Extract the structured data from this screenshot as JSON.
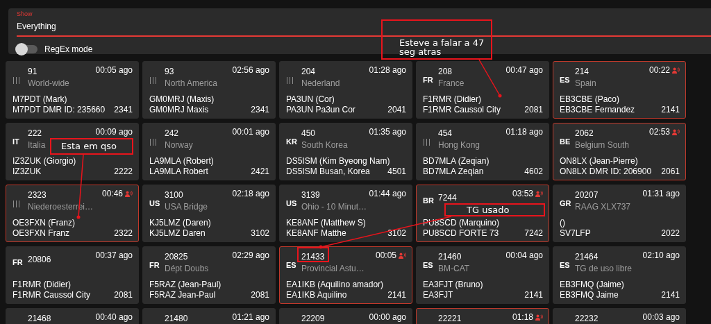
{
  "filter": {
    "label": "Show",
    "value": "Everything",
    "regex_mode": {
      "label": "RegEx mode",
      "on": false
    }
  },
  "cards": [
    {
      "flag_missing": true,
      "tg": "91",
      "name": "World-wide",
      "time": "00:05 ago",
      "talking": false,
      "caller": "M7PDT (Mark)",
      "detail": "M7PDT DMR ID: 235660",
      "id": "2341"
    },
    {
      "flag_missing": true,
      "tg": "93",
      "name": "North America",
      "time": "02:56 ago",
      "talking": false,
      "caller": "GM0MRJ (Maxis)",
      "detail": "GM0MRJ Maxis",
      "id": "2341"
    },
    {
      "flag_missing": true,
      "tg": "204",
      "name": "Nederland",
      "time": "01:28 ago",
      "talking": false,
      "caller": "PA3UN (Cor)",
      "detail": "PA3UN Pa3un Cor",
      "id": "2041"
    },
    {
      "code": "FR",
      "tg": "208",
      "name": "France",
      "time": "00:47 ago",
      "talking": false,
      "caller": "F1RMR (Didier)",
      "detail": "F1RMR Caussol City",
      "id": "2081"
    },
    {
      "code": "ES",
      "tg": "214",
      "name": "Spain",
      "time": "00:22",
      "talking": true,
      "caller": "EB3CBE (Paco)",
      "detail": "EB3CBE Fernandez",
      "id": "2141"
    },
    {
      "code": "IT",
      "tg": "222",
      "name": "Italia",
      "time": "00:09 ago",
      "talking": false,
      "caller": "IZ3ZUK (Giorgio)",
      "detail": "IZ3ZUK",
      "id": "2222"
    },
    {
      "flag_missing": true,
      "tg": "242",
      "name": "Norway",
      "time": "00:01 ago",
      "talking": false,
      "caller": "LA9MLA (Robert)",
      "detail": "LA9MLA Robert",
      "id": "2421"
    },
    {
      "code": "KR",
      "tg": "450",
      "name": "South Korea",
      "time": "01:35 ago",
      "talking": false,
      "caller": "DS5ISM (Kim Byeong Nam)",
      "detail": "DS5ISM Busan, Korea",
      "id": "4501"
    },
    {
      "flag_missing": true,
      "tg": "454",
      "name": "Hong Kong",
      "time": "01:18 ago",
      "talking": false,
      "caller": "BD7MLA (Zeqian)",
      "detail": "BD7MLA Zeqian",
      "id": "4602"
    },
    {
      "code": "BE",
      "tg": "2062",
      "name": "Belgium South",
      "time": "02:53",
      "talking": true,
      "caller": "ON8LX (Jean-Pierre)",
      "detail": "ON8LX DMR ID: 206900",
      "id": "2061"
    },
    {
      "flag_missing": true,
      "tg": "2323",
      "name": "Niederoesterrei…",
      "time": "00:46",
      "talking": true,
      "caller": "OE3FXN (Franz)",
      "detail": "OE3FXN Franz",
      "id": "2322"
    },
    {
      "code": "US",
      "tg": "3100",
      "name": "USA Bridge",
      "time": "02:18 ago",
      "talking": false,
      "caller": "KJ5LMZ (Daren)",
      "detail": "KJ5LMZ Daren",
      "id": "3102"
    },
    {
      "code": "US",
      "tg": "3139",
      "name": "Ohio - 10 Minut…",
      "time": "01:44 ago",
      "talking": false,
      "caller": "KE8ANF (Matthew S)",
      "detail": "KE8ANF Matthe",
      "id": "3102"
    },
    {
      "code": "BR",
      "tg": "7244",
      "time": "03:53",
      "talking": true,
      "caller": "PU8SCD (Marquino)",
      "detail": "PU8SCD FORTE 73",
      "id": "7242"
    },
    {
      "code": "GR",
      "tg": "20207",
      "name": "RAAG XLX737",
      "time": "01:31 ago",
      "talking": false,
      "caller": "()",
      "detail": "SV7LFP",
      "id": "2022"
    },
    {
      "code": "FR",
      "tg": "20806",
      "time": "00:37 ago",
      "talking": false,
      "caller": "F1RMR (Didier)",
      "detail": "F1RMR Caussol City",
      "id": "2081"
    },
    {
      "code": "FR",
      "tg": "20825",
      "name": "Dépt Doubs",
      "time": "02:29 ago",
      "talking": false,
      "caller": "F5RAZ (Jean-Paul)",
      "detail": "F5RAZ Jean-Paul",
      "id": "2081"
    },
    {
      "code": "ES",
      "tg": "21433",
      "name": "Provincial Astu…",
      "time": "00:05",
      "talking": true,
      "caller": "EA1IKB (Aquilino amador)",
      "detail": "EA1IKB Aquilino",
      "id": "2141"
    },
    {
      "code": "ES",
      "tg": "21460",
      "name": "BM-CAT",
      "time": "00:04 ago",
      "talking": false,
      "caller": "EA3FJT (Bruno)",
      "detail": "EA3FJT",
      "id": "2141"
    },
    {
      "code": "ES",
      "tg": "21464",
      "name": "TG de uso libre",
      "time": "02:10 ago",
      "talking": false,
      "caller": "EB3FMQ (Jaime)",
      "detail": "EB3FMQ Jaime",
      "id": "2141"
    },
    {
      "tg": "21468",
      "time": "00:40 ago",
      "talking": false
    },
    {
      "tg": "21480",
      "time": "01:21 ago",
      "talking": false
    },
    {
      "tg": "22209",
      "time": "00:00 ago",
      "talking": false
    },
    {
      "tg": "22221",
      "time": "01:18",
      "talking": true
    },
    {
      "tg": "22232",
      "time": "00:03 ago",
      "talking": false
    }
  ],
  "annotations": [
    {
      "kind": "callout",
      "text": "Esteve a falar a 47 seg atras"
    },
    {
      "kind": "callout",
      "text": "Esta em qso"
    },
    {
      "kind": "callout",
      "text": "TG usado"
    },
    {
      "kind": "frame"
    }
  ]
}
